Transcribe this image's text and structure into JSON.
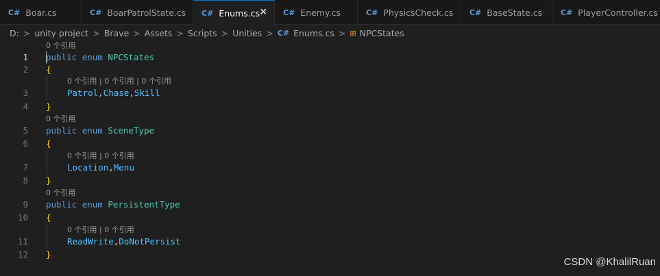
{
  "tabs": [
    {
      "label": "Boar.cs",
      "icon": "csharp-file-icon",
      "active": false
    },
    {
      "label": "BoarPatrolState.cs",
      "icon": "csharp-file-icon",
      "active": false
    },
    {
      "label": "Enums.cs",
      "icon": "csharp-file-icon",
      "active": true
    },
    {
      "label": "Enemy.cs",
      "icon": "csharp-file-icon",
      "active": false
    },
    {
      "label": "PhysicsCheck.cs",
      "icon": "csharp-file-icon",
      "active": false
    },
    {
      "label": "BaseState.cs",
      "icon": "csharp-file-icon",
      "active": false
    },
    {
      "label": "PlayerController.cs",
      "icon": "csharp-file-icon",
      "active": false
    }
  ],
  "tab_icon_glyph": "C#",
  "close_glyph": "✕",
  "breadcrumb": {
    "segments": [
      "D:",
      "unity project",
      "Brave",
      "Assets",
      "Scripts",
      "Unities",
      "Enums.cs",
      "NPCStates"
    ],
    "separator": ">",
    "cs_glyph": "C#",
    "enum_glyph": "⊞"
  },
  "code": {
    "line_numbers": [
      "1",
      "2",
      "3",
      "4",
      "5",
      "6",
      "7",
      "8",
      "9",
      "10",
      "11",
      "12"
    ],
    "lens": {
      "l1": "0 个引用",
      "l3": "0 个引用 | 0 个引用 | 0 个引用",
      "l5": "0 个引用",
      "l7": "0 个引用 | 0 个引用",
      "l9": "0 个引用",
      "l11": "0 个引用 | 0 个引用"
    },
    "kw_public": "public",
    "kw_enum": "enum",
    "open_brace": "{",
    "close_brace": "}",
    "comma": ",",
    "enum1": {
      "name": "NPCStates",
      "members": [
        "Patrol",
        "Chase",
        "Skill"
      ]
    },
    "enum2": {
      "name": "SceneType",
      "members": [
        "Location",
        "Menu"
      ]
    },
    "enum3": {
      "name": "PersistentType",
      "members": [
        "ReadWrite",
        "DoNotPersist"
      ]
    }
  },
  "watermark": "CSDN @KhalilRuan",
  "colors": {
    "keyword": "#569cd6",
    "type": "#4ec9b0",
    "identifier": "#4fc1ff",
    "brace": "#ffd700",
    "active_tab_border": "#0078d4"
  }
}
